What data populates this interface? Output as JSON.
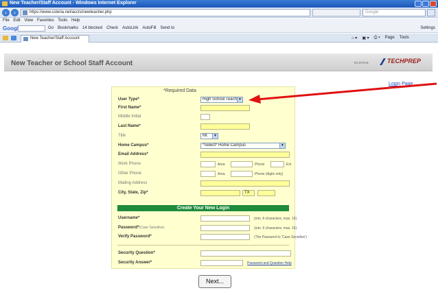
{
  "window": {
    "title": "New Teacher/Staff Account - Windows Internet Explorer"
  },
  "browser": {
    "url": "https://www.csteria.net/accts/newteacher.php",
    "search_placeholder": "Google",
    "menu": [
      "File",
      "Edit",
      "View",
      "Favorites",
      "Tools",
      "Help"
    ],
    "google_label": "Google",
    "toolbar_items": [
      "Go",
      "Bookmarks",
      "14 blocked",
      "Check",
      "AutoLink",
      "AutoFill",
      "Send to"
    ],
    "settings_label": "Settings",
    "tab_title": "New Teacher/Staff Account",
    "tab_tools": [
      "Page",
      "Tools"
    ]
  },
  "page": {
    "title": "New Teacher or School Staff Account",
    "header_small": "tecomma",
    "logo_text": "TECHPREP",
    "login_link": "Login Page",
    "required_note": "*Required Data"
  },
  "form": {
    "user_type_label": "User Type*",
    "user_type_value": "High School Teacher",
    "first_name_label": "First Name*",
    "middle_initial_label": "Middle Initial",
    "last_name_label": "Last Name*",
    "title_label": "Title",
    "title_value": "Mr.",
    "home_campus_label": "Home Campus*",
    "home_campus_value": "*Select* Home Campus",
    "email_label": "Email Address*",
    "work_phone_label": "Work Phone",
    "other_phone_label": "Other Phone",
    "mailing_address_label": "Mailing Address",
    "city_state_zip_label": "City, State, Zip*",
    "state_value": "TX",
    "hint_area": "Area",
    "hint_phone": "Phone",
    "hint_ext": "Ext",
    "hint_digits": "Phone (digits only)",
    "section_title": "Create Your New Login",
    "username_label": "Username*",
    "username_hint": "(min. 6 characters, max. 15)",
    "password_label": "Password*",
    "password_label_note": "(Case Sensitive)",
    "password_hint": "(min. 6 characters, max. 15)",
    "verify_password_label": "Verify Password*",
    "verify_hint": "(The Password is 'Case Sensitive')",
    "security_question_label": "Security Question*",
    "security_answer_label": "Security Answer*",
    "help_link": "Password and Question Help",
    "next_button": "Next..."
  },
  "colors": {
    "form_bg": "#ffffd0",
    "field_bg": "#ffff99",
    "section_green": "#1e8a3c",
    "arrow_red": "#e01010"
  }
}
